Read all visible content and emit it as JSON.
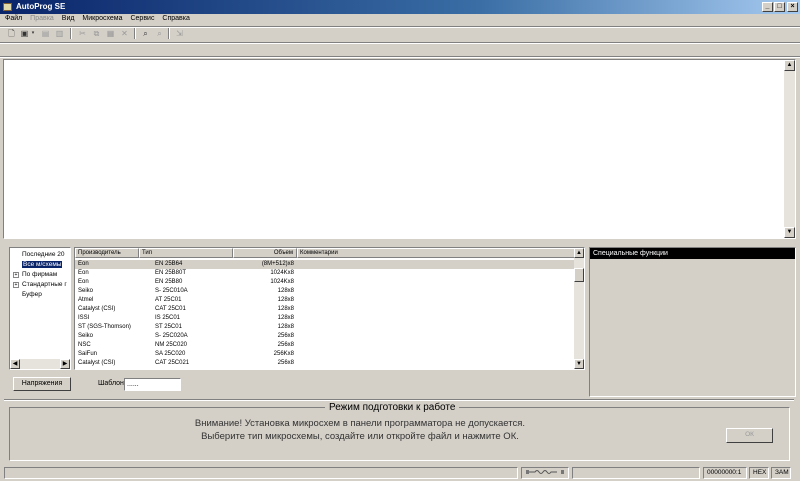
{
  "window": {
    "title": "AutoProg SE",
    "minimize": "_",
    "maximize": "□",
    "close": "×"
  },
  "menu": [
    "Файл",
    "Правка",
    "Вид",
    "Микросхема",
    "Сервис",
    "Справка"
  ],
  "tree": {
    "items": [
      {
        "label": "Последние 20",
        "expander": ""
      },
      {
        "label": "Все м/схемы",
        "expander": ""
      },
      {
        "label": "По фирмам",
        "expander": "+"
      },
      {
        "label": "Стандартные г",
        "expander": "+"
      },
      {
        "label": "Буфер",
        "expander": ""
      }
    ]
  },
  "chip_list": {
    "columns": [
      "Производитель",
      "Тип",
      "Объем",
      "Комментарии"
    ],
    "rows": [
      {
        "maker": "Eon",
        "type": "EN 25B64",
        "size": "(8M+512)x8"
      },
      {
        "maker": "Eon",
        "type": "EN 25B80T",
        "size": "1024Kx8"
      },
      {
        "maker": "Eon",
        "type": "EN 25B80",
        "size": "1024Kx8"
      },
      {
        "maker": "Seiko",
        "type": "S- 25C010A",
        "size": "128x8"
      },
      {
        "maker": "Atmel",
        "type": "AT 25C01",
        "size": "128x8"
      },
      {
        "maker": "Catalyst (CSI)",
        "type": "CAT 25C01",
        "size": "128x8"
      },
      {
        "maker": "ISSI",
        "type": "IS 25C01",
        "size": "128x8"
      },
      {
        "maker": "ST (SGS-Thomson)",
        "type": "ST 25C01",
        "size": "128x8"
      },
      {
        "maker": "Seiko",
        "type": "S- 25C020A",
        "size": "256x8"
      },
      {
        "maker": "NSC",
        "type": "NM 25C020",
        "size": "256x8"
      },
      {
        "maker": "SaiFun",
        "type": "SA 25C020",
        "size": "256Kx8"
      },
      {
        "maker": "Catalyst (CSI)",
        "type": "CAT 25C021",
        "size": "256x8"
      },
      {
        "maker": "Catalyst (CSI)",
        "type": "CAT 25C022",
        "size": "256x8"
      }
    ]
  },
  "special_functions": {
    "title": "Специальные функции"
  },
  "controls": {
    "voltages_button": "Напряжения",
    "template_label": "Шаблон",
    "template_value": "......"
  },
  "mode_panel": {
    "title": "Режим подготовки к работе",
    "line1": "Внимание! Установка микросхем в панели программатора не допускается.",
    "line2": "Выберите тип микросхемы, создайте или откройте файл и нажмите ОК.",
    "ok_button": "ОК"
  },
  "status": {
    "address": "00000000:1",
    "mode": "HEX",
    "insert": "ЗАМ"
  }
}
